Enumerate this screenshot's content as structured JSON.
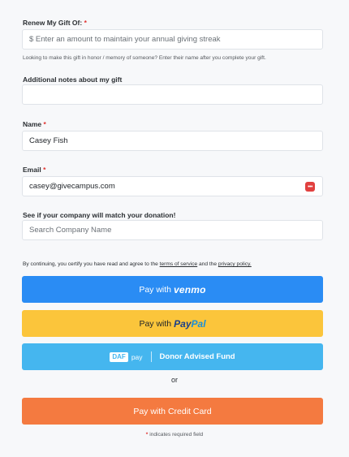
{
  "gift": {
    "label": "Renew My Gift Of:",
    "required_mark": "*",
    "placeholder": "$ Enter an amount to maintain your annual giving streak",
    "hint": "Looking to make this gift in honor / memory of someone? Enter their name after you complete your gift."
  },
  "notes": {
    "label": "Additional notes about my gift",
    "value": ""
  },
  "name": {
    "label": "Name",
    "required_mark": "*",
    "value": "Casey Fish"
  },
  "email": {
    "label": "Email",
    "required_mark": "*",
    "value": "casey@givecampus.com",
    "icon": "password-manager-icon"
  },
  "company": {
    "label": "See if your company will match your donation!",
    "placeholder": "Search Company Name"
  },
  "terms": {
    "prefix": "By continuing, you certify you have read and agree to the ",
    "tos_link": "terms of service",
    "middle": " and the ",
    "privacy_link": "privacy policy."
  },
  "buttons": {
    "venmo_prefix": "Pay with",
    "venmo_brand": "venmo",
    "paypal_prefix": "Pay with",
    "paypal_brand_pay": "Pay",
    "paypal_brand_pal": "Pal",
    "daf_badge": "DAF",
    "daf_pay": "pay",
    "daf_label": "Donor Advised Fund",
    "or": "or",
    "credit_card": "Pay with Credit Card"
  },
  "footer": {
    "required_mark": "*",
    "text": "indicates required field"
  },
  "colors": {
    "venmo": "#2a8cf4",
    "paypal": "#fbc53b",
    "daf": "#45b6ef",
    "credit_card": "#f47a40",
    "required": "#e0312f"
  }
}
